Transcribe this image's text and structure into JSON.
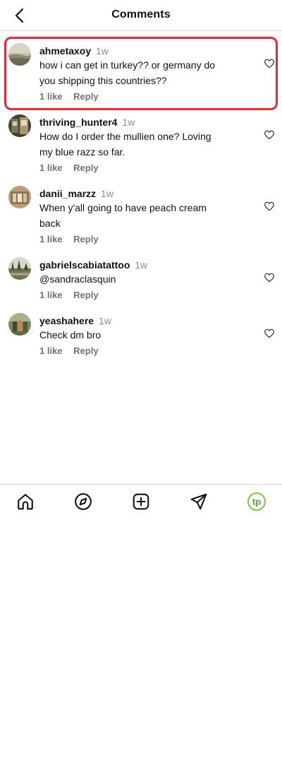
{
  "header": {
    "title": "Comments"
  },
  "comments": [
    {
      "username": "ahmetaxoy",
      "time": "1w",
      "text_lines": [
        "how i can get in turkey?? or germany do",
        "you shipping this countries??"
      ],
      "likes": "1 like",
      "reply": "Reply",
      "highlighted": true
    },
    {
      "username": "thriving_hunter4",
      "time": "1w",
      "text_lines": [
        "How do I order the mullien one? Loving",
        "my blue razz so far."
      ],
      "likes": "1 like",
      "reply": "Reply"
    },
    {
      "username": "danii_marzz",
      "time": "1w",
      "text_lines": [
        "When y'all going to have peach cream",
        "back"
      ],
      "likes": "1 like",
      "reply": "Reply"
    },
    {
      "username": "gabrielscabiatattoo",
      "time": "1w",
      "text_lines": [
        "@sandraclasquin"
      ],
      "likes": "1 like",
      "reply": "Reply"
    },
    {
      "username": "yeashahere",
      "time": "1w",
      "text_lines": [
        "Check dm bro"
      ],
      "likes": "1 like",
      "reply": "Reply"
    }
  ],
  "nav": {
    "items": [
      "home-icon",
      "explore-icon",
      "create-icon",
      "direct-icon",
      "profile-icon"
    ],
    "profile_initials": "tp",
    "accent_color": "#7ac943"
  },
  "colors": {
    "highlight": "#e8283b",
    "muted": "#737373"
  }
}
